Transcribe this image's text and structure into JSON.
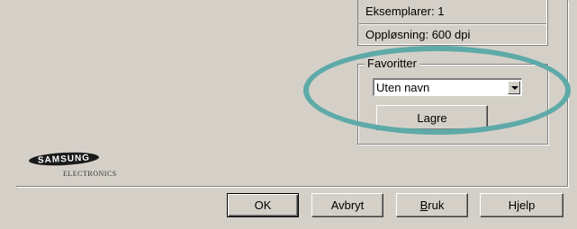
{
  "info": {
    "copies": "Eksemplarer: 1",
    "resolution": "Oppløsning: 600 dpi"
  },
  "favorites": {
    "legend": "Favoritter",
    "selected": "Uten navn",
    "save_label": "Lagre"
  },
  "brand": {
    "name": "SAMSUNG",
    "sub": "ELECTRONICS"
  },
  "buttons": {
    "ok": "OK",
    "cancel": "Avbryt",
    "apply_prefix": "",
    "apply_u": "B",
    "apply_rest": "ruk",
    "help": "Hjelp"
  },
  "colors": {
    "dialog_bg": "#d4d0c8",
    "highlight_ring": "#5eaaa8"
  },
  "icons": {
    "combo_arrow": "chevron-down-icon",
    "logo": "samsung-logo"
  }
}
